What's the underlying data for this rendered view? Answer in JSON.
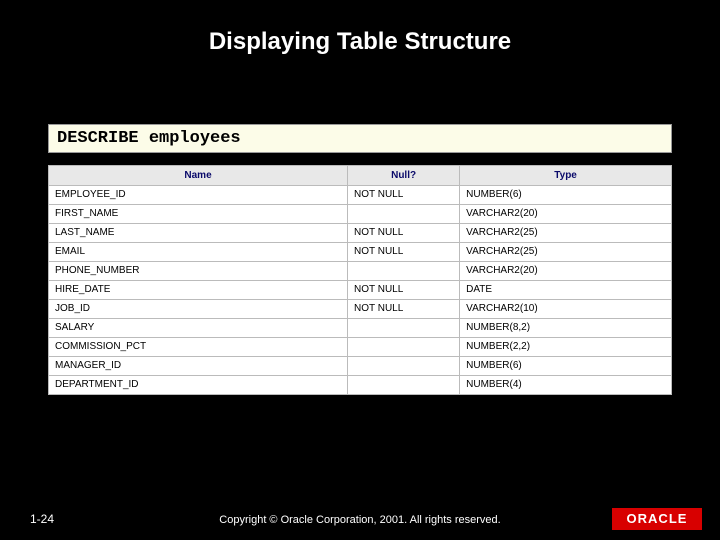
{
  "title": "Displaying Table Structure",
  "command": "DESCRIBE employees",
  "columns": {
    "name": "Name",
    "null": "Null?",
    "type": "Type"
  },
  "rows": [
    {
      "name": "EMPLOYEE_ID",
      "null": "NOT NULL",
      "type": "NUMBER(6)"
    },
    {
      "name": "FIRST_NAME",
      "null": "",
      "type": "VARCHAR2(20)"
    },
    {
      "name": "LAST_NAME",
      "null": "NOT NULL",
      "type": "VARCHAR2(25)"
    },
    {
      "name": "EMAIL",
      "null": "NOT NULL",
      "type": "VARCHAR2(25)"
    },
    {
      "name": "PHONE_NUMBER",
      "null": "",
      "type": "VARCHAR2(20)"
    },
    {
      "name": "HIRE_DATE",
      "null": "NOT NULL",
      "type": "DATE"
    },
    {
      "name": "JOB_ID",
      "null": "NOT NULL",
      "type": "VARCHAR2(10)"
    },
    {
      "name": "SALARY",
      "null": "",
      "type": "NUMBER(8,2)"
    },
    {
      "name": "COMMISSION_PCT",
      "null": "",
      "type": "NUMBER(2,2)"
    },
    {
      "name": "MANAGER_ID",
      "null": "",
      "type": "NUMBER(6)"
    },
    {
      "name": "DEPARTMENT_ID",
      "null": "",
      "type": "NUMBER(4)"
    }
  ],
  "footer": {
    "pagenum": "1-24",
    "copyright": "Copyright © Oracle Corporation, 2001. All rights reserved.",
    "logo": "ORACLE"
  }
}
